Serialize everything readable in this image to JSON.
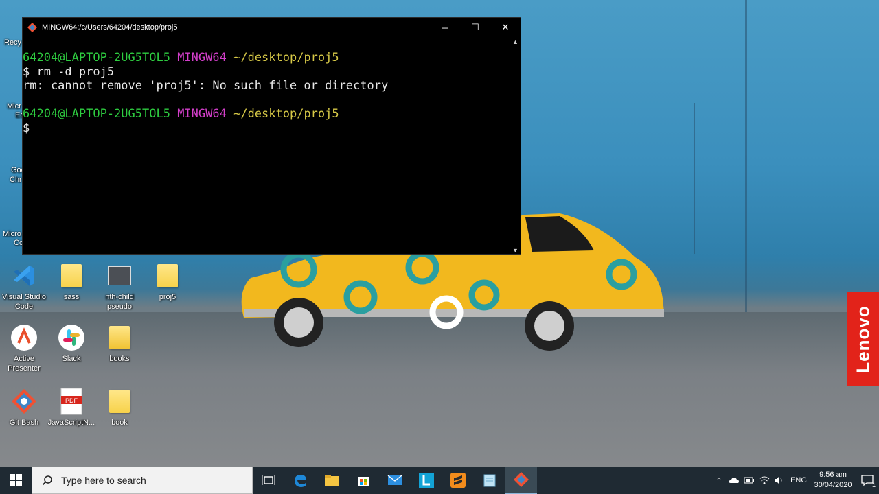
{
  "desktop": {
    "icons": [
      {
        "label": "Visual Studio Code"
      },
      {
        "label": "sass"
      },
      {
        "label": "nth-child pseudo"
      },
      {
        "label": "proj5"
      },
      {
        "label": "Active Presenter"
      },
      {
        "label": "Slack"
      },
      {
        "label": "books"
      },
      {
        "label": "Git Bash"
      },
      {
        "label": "JavaScriptN..."
      },
      {
        "label": "book"
      }
    ],
    "partial_labels": {
      "recycle": "Recy",
      "edge_1": "Micr",
      "edge_2": "Ed",
      "chrome_1": "Goo",
      "chrome_2": "Chr",
      "office_1": "Micro",
      "office_2": "Co"
    },
    "brand": "Lenovo"
  },
  "terminal": {
    "title": "MINGW64:/c/Users/64204/desktop/proj5",
    "lines": [
      {
        "user": "64204@LAPTOP-2UG5TOL5",
        "env": "MINGW64",
        "path": "~/desktop/proj5"
      },
      {
        "text": "$ rm -d proj5"
      },
      {
        "text": "rm: cannot remove 'proj5': No such file or directory"
      },
      {
        "text": ""
      },
      {
        "user": "64204@LAPTOP-2UG5TOL5",
        "env": "MINGW64",
        "path": "~/desktop/proj5"
      },
      {
        "text": "$"
      }
    ],
    "buttons": {
      "minimize": "─",
      "maximize": "☐",
      "close": "✕"
    }
  },
  "taskbar": {
    "search_placeholder": "Type here to search",
    "language": "ENG",
    "time": "9:56 am",
    "date": "30/04/2020",
    "notifications_count": "1"
  },
  "colors": {
    "prompt_user": "#2ecc40",
    "prompt_env": "#d43fcb",
    "prompt_path": "#d7c947",
    "taskbar_bg": "#1f2a33"
  }
}
